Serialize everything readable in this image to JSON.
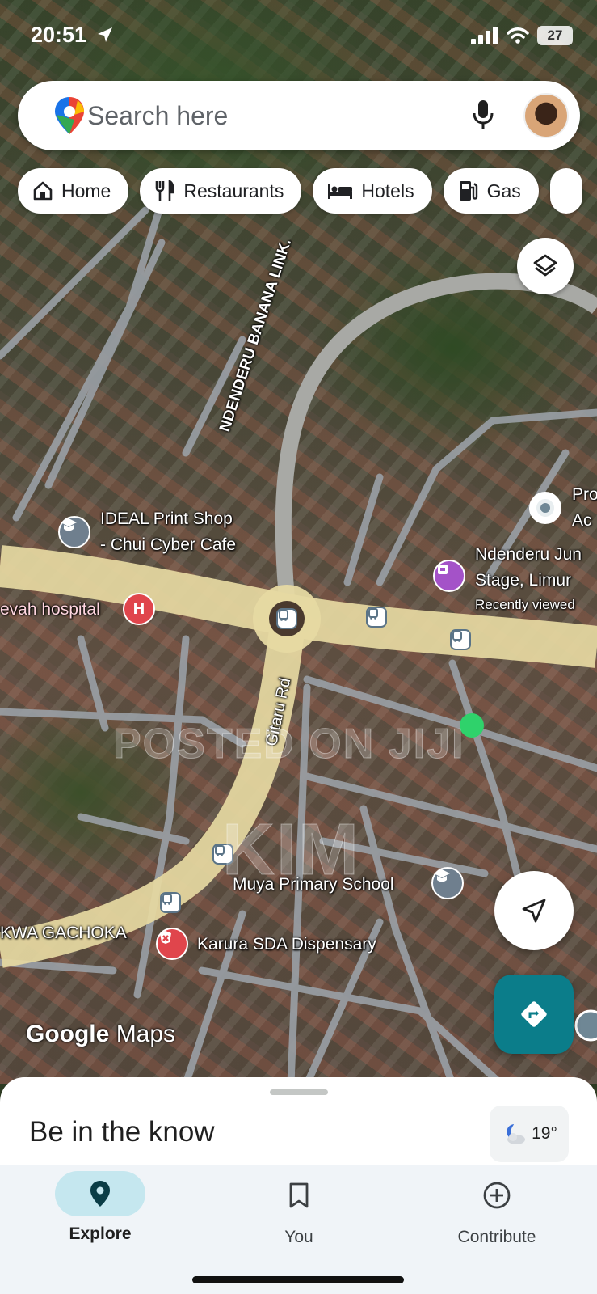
{
  "status_bar": {
    "time": "20:51",
    "battery": "27"
  },
  "search": {
    "placeholder": "Search here"
  },
  "chips": [
    {
      "label": "Home",
      "icon": "home-icon"
    },
    {
      "label": "Restaurants",
      "icon": "restaurant-icon"
    },
    {
      "label": "Hotels",
      "icon": "hotel-icon"
    },
    {
      "label": "Gas",
      "icon": "gas-station-icon"
    }
  ],
  "map": {
    "roads": {
      "gitaru": "Gitaru Rd",
      "ndenderu": "NDENDERU BANANA LINK."
    },
    "places": {
      "ideal_line1": "IDEAL Print Shop",
      "ideal_line2": "- Chui Cyber Cafe",
      "hospital": "evah hospital",
      "ndenderu_line1": "Ndenderu Jun",
      "ndenderu_line2": "Stage, Limur",
      "ndenderu_sub": "Recently viewed",
      "pro_line1": "Pro",
      "pro_line2": "Ac",
      "school": "Muya Primary School",
      "gachoka": "KWA GACHOKA",
      "dispensary": "Karura SDA Dispensary"
    },
    "watermark_1": "POSTED ON JIJI",
    "watermark_2": "KIM"
  },
  "branding": {
    "google": "Google",
    "maps": "Maps"
  },
  "sheet": {
    "title": "Be in the know",
    "weather": "19°"
  },
  "nav": [
    {
      "label": "Explore",
      "active": true
    },
    {
      "label": "You",
      "active": false
    },
    {
      "label": "Contribute",
      "active": false
    }
  ],
  "colors": {
    "accent": "#0b7d8a",
    "nav_pill": "#c5e7ef",
    "hospital_pin": "#e0454c",
    "shop_pin": "#a452c8"
  }
}
